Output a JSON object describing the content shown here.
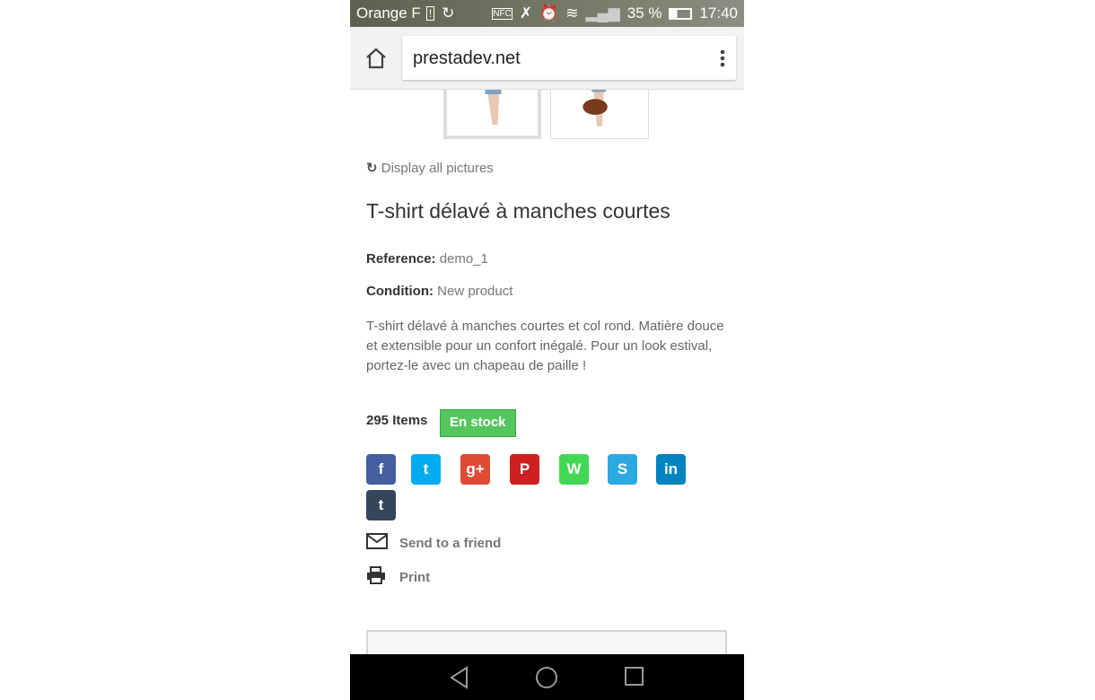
{
  "status_bar": {
    "carrier": "Orange F",
    "battery": "35 %",
    "time": "17:40",
    "icons": [
      "sim-icon",
      "sync-icon",
      "nfc-icon",
      "mute-icon",
      "alarm-icon",
      "wifi-icon",
      "signal-icon",
      "battery-icon"
    ]
  },
  "browser": {
    "url": "prestadev.net"
  },
  "product": {
    "display_all": "Display all pictures",
    "title": "T-shirt délavé à manches courtes",
    "reference_label": "Reference:",
    "reference": "demo_1",
    "condition_label": "Condition:",
    "condition": "New product",
    "description": "T-shirt délavé à manches courtes et col rond. Matière douce et extensible pour un confort inégalé. Pour un look estival, portez-le avec un chapeau de paille !",
    "quantity": "295 Items",
    "availability": "En stock"
  },
  "social": [
    {
      "name": "facebook",
      "glyph": "f",
      "color": "#435f9f"
    },
    {
      "name": "twitter",
      "glyph": "t",
      "color": "#00aced"
    },
    {
      "name": "google-plus",
      "glyph": "g+",
      "color": "#e04b34"
    },
    {
      "name": "pinterest",
      "glyph": "P",
      "color": "#ce1f21"
    },
    {
      "name": "whatsapp",
      "glyph": "W",
      "color": "#43d854"
    },
    {
      "name": "skype",
      "glyph": "S",
      "color": "#2ca9e1"
    },
    {
      "name": "linkedin",
      "glyph": "in",
      "color": "#0084bf"
    },
    {
      "name": "tumblr",
      "glyph": "t",
      "color": "#35465c"
    }
  ],
  "actions": {
    "send": "Send to a friend",
    "print": "Print"
  }
}
